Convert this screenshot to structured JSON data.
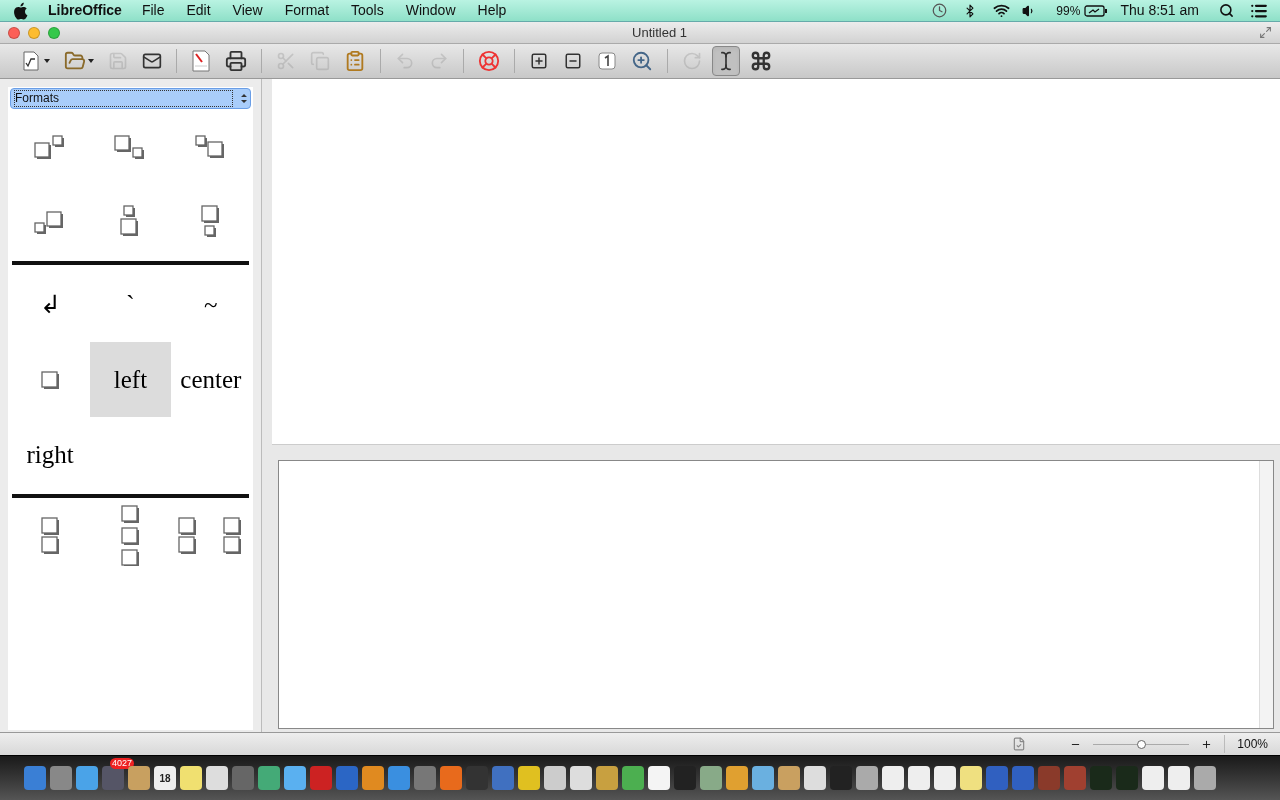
{
  "menu_bar": {
    "app_name": "LibreOffice",
    "menus": [
      "File",
      "Edit",
      "View",
      "Format",
      "Tools",
      "Window",
      "Help"
    ],
    "battery_percent": "99%",
    "clock": "Thu 8:51 am"
  },
  "window": {
    "title": "Untitled 1"
  },
  "toolbar": {
    "buttons": [
      {
        "disabled": false,
        "selected": false
      },
      {
        "disabled": false,
        "selected": false
      },
      {
        "disabled": true,
        "selected": false
      },
      {
        "disabled": false,
        "selected": false
      },
      {
        "disabled": false,
        "selected": false
      },
      {
        "disabled": false,
        "selected": false
      },
      {
        "disabled": true,
        "selected": false
      },
      {
        "disabled": true,
        "selected": false
      },
      {
        "disabled": false,
        "selected": false
      },
      {
        "disabled": true,
        "selected": false
      },
      {
        "disabled": true,
        "selected": false
      },
      {
        "disabled": false,
        "selected": false
      },
      {
        "disabled": false,
        "selected": false
      },
      {
        "disabled": false,
        "selected": false
      },
      {
        "disabled": false,
        "selected": false
      },
      {
        "disabled": false,
        "selected": false
      },
      {
        "disabled": true,
        "selected": false
      },
      {
        "disabled": false,
        "selected": true
      },
      {
        "disabled": false,
        "selected": false
      }
    ]
  },
  "elements": {
    "category": "Formats",
    "sections": [
      [
        {
          "kind": "shape",
          "selected": false
        },
        {
          "kind": "shape",
          "selected": false
        },
        {
          "kind": "shape",
          "selected": false
        },
        {
          "kind": "shape",
          "selected": false
        },
        {
          "kind": "shape",
          "selected": false
        },
        {
          "kind": "shape",
          "selected": false
        }
      ],
      [
        {
          "kind": "text",
          "label": "↲",
          "selected": false
        },
        {
          "kind": "text",
          "label": "`",
          "selected": false
        },
        {
          "kind": "text",
          "label": "~",
          "selected": false
        },
        {
          "kind": "shape",
          "selected": false
        },
        {
          "kind": "text",
          "label": "left",
          "selected": true
        },
        {
          "kind": "text",
          "label": "center",
          "selected": false
        },
        {
          "kind": "text",
          "label": "right",
          "selected": false
        }
      ],
      [
        {
          "kind": "shape",
          "selected": false
        },
        {
          "kind": "shape",
          "selected": false
        },
        {
          "kind": "shape",
          "selected": false
        }
      ]
    ]
  },
  "status_bar": {
    "zoom": {
      "level": 0.5
    },
    "zoom_percent": "100%"
  },
  "dock": {
    "mail_badge": "4027",
    "calendar_day": "18"
  }
}
